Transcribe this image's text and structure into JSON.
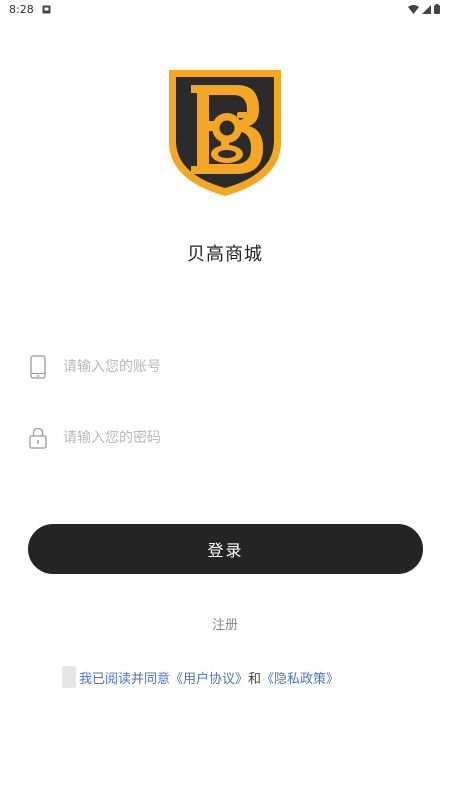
{
  "status_bar": {
    "time": "8:28"
  },
  "app": {
    "title": "贝高商城",
    "logo_letters": "Bg",
    "logo_colors": {
      "outer": "#F5A623",
      "inner": "#2B2B2B"
    }
  },
  "form": {
    "account_placeholder": "请输入您的账号",
    "password_placeholder": "请输入您的密码",
    "login_label": "登录",
    "register_label": "注册"
  },
  "agreement": {
    "checked": false,
    "text": "我已阅读并同意",
    "user_agreement": "《用户协议》",
    "and": "和",
    "privacy_policy": "《隐私政策》"
  },
  "colors": {
    "button": "#242424",
    "link": "#4A74C9",
    "placeholder": "#B8B8B8"
  }
}
